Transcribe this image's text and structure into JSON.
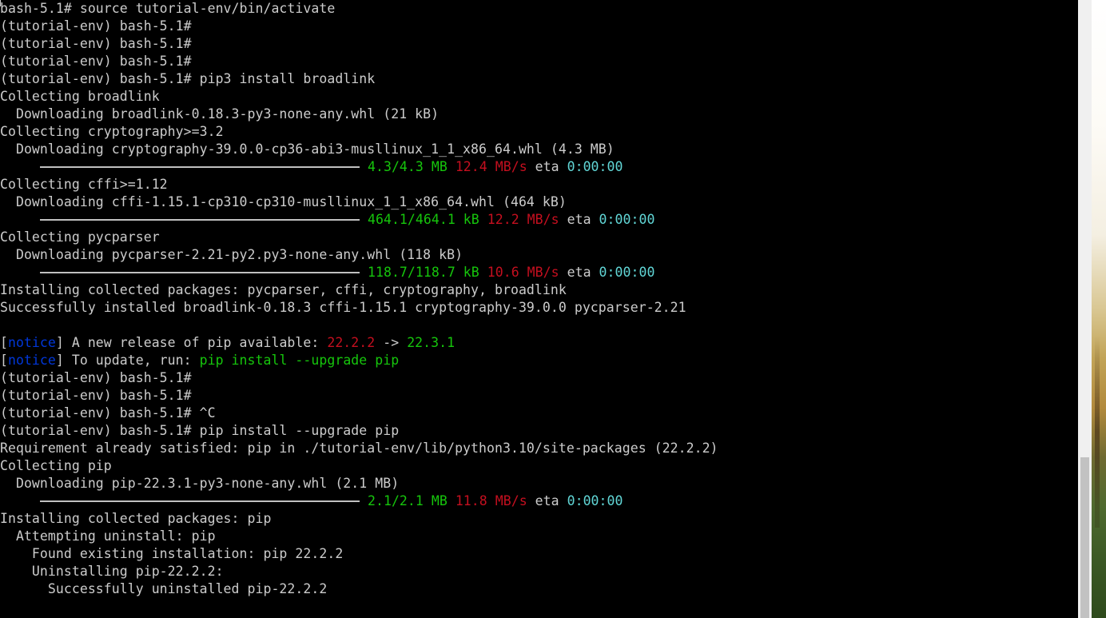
{
  "terminal": {
    "lines": [
      [
        {
          "t": "bash-5.1# source tutorial-env/bin/activate",
          "c": "w"
        }
      ],
      [
        {
          "t": "(tutorial-env) bash-5.1#",
          "c": "w"
        }
      ],
      [
        {
          "t": "(tutorial-env) bash-5.1#",
          "c": "w"
        }
      ],
      [
        {
          "t": "(tutorial-env) bash-5.1#",
          "c": "w"
        }
      ],
      [
        {
          "t": "(tutorial-env) bash-5.1# pip3 install broadlink",
          "c": "w"
        }
      ],
      [
        {
          "t": "Collecting broadlink",
          "c": "w"
        }
      ],
      [
        {
          "t": "  Downloading broadlink-0.18.3-py3-none-any.whl (21 kB)",
          "c": "w"
        }
      ],
      [
        {
          "t": "Collecting cryptography>=3.2",
          "c": "w"
        }
      ],
      [
        {
          "t": "  Downloading cryptography-39.0.0-cp36-abi3-musllinux_1_1_x86_64.whl (4.3 MB)",
          "c": "w"
        }
      ],
      [
        {
          "bar": true
        },
        {
          "t": "4.3/4.3 MB",
          "c": "g"
        },
        {
          "t": " ",
          "c": "w"
        },
        {
          "t": "12.4 MB/s",
          "c": "r"
        },
        {
          "t": " eta ",
          "c": "w"
        },
        {
          "t": "0:00:00",
          "c": "c"
        }
      ],
      [
        {
          "t": "Collecting cffi>=1.12",
          "c": "w"
        }
      ],
      [
        {
          "t": "  Downloading cffi-1.15.1-cp310-cp310-musllinux_1_1_x86_64.whl (464 kB)",
          "c": "w"
        }
      ],
      [
        {
          "bar": true
        },
        {
          "t": "464.1/464.1 kB",
          "c": "g"
        },
        {
          "t": " ",
          "c": "w"
        },
        {
          "t": "12.2 MB/s",
          "c": "r"
        },
        {
          "t": " eta ",
          "c": "w"
        },
        {
          "t": "0:00:00",
          "c": "c"
        }
      ],
      [
        {
          "t": "Collecting pycparser",
          "c": "w"
        }
      ],
      [
        {
          "t": "  Downloading pycparser-2.21-py2.py3-none-any.whl (118 kB)",
          "c": "w"
        }
      ],
      [
        {
          "bar": true
        },
        {
          "t": "118.7/118.7 kB",
          "c": "g"
        },
        {
          "t": " ",
          "c": "w"
        },
        {
          "t": "10.6 MB/s",
          "c": "r"
        },
        {
          "t": " eta ",
          "c": "w"
        },
        {
          "t": "0:00:00",
          "c": "c"
        }
      ],
      [
        {
          "t": "Installing collected packages: pycparser, cffi, cryptography, broadlink",
          "c": "w"
        }
      ],
      [
        {
          "t": "Successfully installed broadlink-0.18.3 cffi-1.15.1 cryptography-39.0.0 pycparser-2.21",
          "c": "w"
        }
      ],
      [
        {
          "t": "",
          "c": "w"
        }
      ],
      [
        {
          "t": "[",
          "c": "w"
        },
        {
          "t": "notice",
          "c": "b"
        },
        {
          "t": "] A new release of pip available: ",
          "c": "w"
        },
        {
          "t": "22.2.2",
          "c": "r"
        },
        {
          "t": " -> ",
          "c": "w"
        },
        {
          "t": "22.3.1",
          "c": "g"
        }
      ],
      [
        {
          "t": "[",
          "c": "w"
        },
        {
          "t": "notice",
          "c": "b"
        },
        {
          "t": "] To update, run: ",
          "c": "w"
        },
        {
          "t": "pip install --upgrade pip",
          "c": "g"
        }
      ],
      [
        {
          "t": "(tutorial-env) bash-5.1#",
          "c": "w"
        }
      ],
      [
        {
          "t": "(tutorial-env) bash-5.1#",
          "c": "w"
        }
      ],
      [
        {
          "t": "(tutorial-env) bash-5.1# ^C",
          "c": "w"
        }
      ],
      [
        {
          "t": "(tutorial-env) bash-5.1# pip install --upgrade pip",
          "c": "w"
        }
      ],
      [
        {
          "t": "Requirement already satisfied: pip in ./tutorial-env/lib/python3.10/site-packages (22.2.2)",
          "c": "w"
        }
      ],
      [
        {
          "t": "Collecting pip",
          "c": "w"
        }
      ],
      [
        {
          "t": "  Downloading pip-22.3.1-py3-none-any.whl (2.1 MB)",
          "c": "w"
        }
      ],
      [
        {
          "bar": true
        },
        {
          "t": "2.1/2.1 MB",
          "c": "g"
        },
        {
          "t": " ",
          "c": "w"
        },
        {
          "t": "11.8 MB/s",
          "c": "r"
        },
        {
          "t": " eta ",
          "c": "w"
        },
        {
          "t": "0:00:00",
          "c": "c"
        }
      ],
      [
        {
          "t": "Installing collected packages: pip",
          "c": "w"
        }
      ],
      [
        {
          "t": "  Attempting uninstall: pip",
          "c": "w"
        }
      ],
      [
        {
          "t": "    Found existing installation: pip 22.2.2",
          "c": "w"
        }
      ],
      [
        {
          "t": "    Uninstalling pip-22.2.2:",
          "c": "w"
        }
      ],
      [
        {
          "t": "      Successfully uninstalled pip-22.2.2",
          "c": "w"
        }
      ]
    ]
  },
  "colors": {
    "background": "#000000",
    "text": "#cccccc",
    "green": "#16c60c",
    "red": "#c50f1f",
    "cyan": "#61d6d6",
    "blue": "#0037da",
    "progress_bar": "#c0c0c0",
    "scrollbar_track": "#f0f0f0",
    "scrollbar_thumb": "#c2c2c2"
  },
  "progress": {
    "bars_complete_fraction": [
      1.0,
      1.0,
      1.0,
      1.0
    ]
  }
}
